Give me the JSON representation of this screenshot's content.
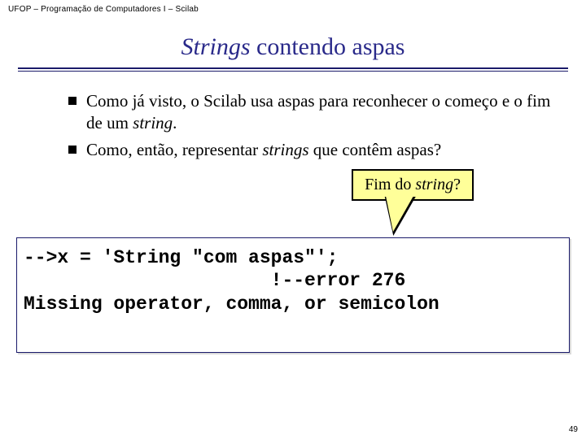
{
  "header": "UFOP – Programação de Computadores I – Scilab",
  "title": {
    "italic": "Strings",
    "rest": " contendo aspas"
  },
  "bullets": [
    {
      "pre": "Como já visto, o Scilab usa aspas para reconhecer o começo e o fim de um ",
      "it": "string",
      "post": "."
    },
    {
      "pre": "Como, então, representar ",
      "it": "strings",
      "post": " que contêm aspas?"
    }
  ],
  "callout": {
    "pre": "Fim do ",
    "it": "string",
    "post": "?"
  },
  "code": "-->x = 'String \"com aspas\"';\n                      !--error 276\nMissing operator, comma, or semicolon",
  "pagenum": "49"
}
